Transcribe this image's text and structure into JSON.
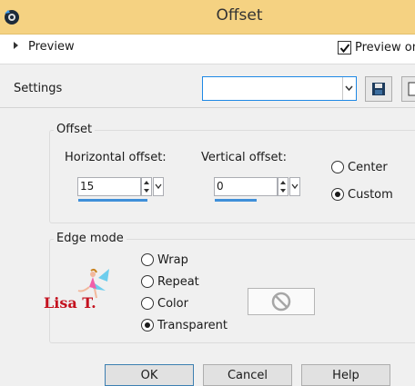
{
  "window": {
    "title": "Offset"
  },
  "preview": {
    "label": "Preview",
    "preview_on_label": "Preview on",
    "preview_on_checked": true
  },
  "settings": {
    "label": "Settings",
    "value": ""
  },
  "offset": {
    "group_title": "Offset",
    "horizontal_label": "Horizontal offset:",
    "horizontal_value": "15",
    "vertical_label": "Vertical offset:",
    "vertical_value": "0",
    "position_options": [
      "Center",
      "Custom"
    ],
    "position_selected": "Custom"
  },
  "edge_mode": {
    "group_title": "Edge mode",
    "options": [
      "Wrap",
      "Repeat",
      "Color",
      "Transparent"
    ],
    "selected": "Transparent"
  },
  "watermark": {
    "text": "Lisa T."
  },
  "buttons": {
    "ok": "OK",
    "cancel": "Cancel",
    "help": "Help"
  },
  "colors": {
    "title_bar": "#f5d282",
    "accent": "#1e88e5",
    "spin_bar": "#3f8fd9"
  }
}
